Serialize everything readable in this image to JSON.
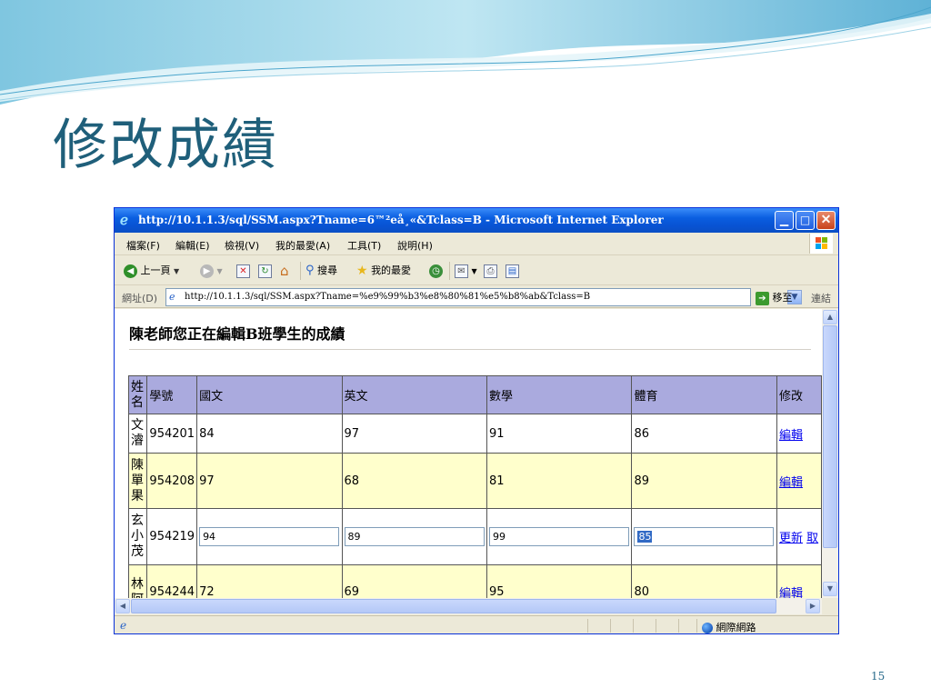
{
  "slide": {
    "title": "修改成績",
    "page_number": "15"
  },
  "browser": {
    "window_title": "http://10.1.1.3/sql/SSM.aspx?Tname=6™²eå¸«&Tclass=B - Microsoft Internet Explorer",
    "menu": [
      "檔案(F)",
      "編輯(E)",
      "檢視(V)",
      "我的最愛(A)",
      "工具(T)",
      "說明(H)"
    ],
    "toolbar": {
      "back_label": "上一頁",
      "search_label": "搜尋",
      "favorites_label": "我的最愛"
    },
    "address": {
      "label": "網址(D)",
      "url": "http://10.1.1.3/sql/SSM.aspx?Tname=%e9%99%b3%e8%80%81%e5%b8%ab&Tclass=B",
      "go_label": "移至",
      "links_label": "連結"
    },
    "status": {
      "zone_label": "網際網路"
    }
  },
  "page": {
    "heading": "陳老師您正在編輯B班學生的成績",
    "columns": [
      "姓名",
      "學號",
      "國文",
      "英文",
      "數學",
      "體育",
      "修改"
    ],
    "rows": [
      {
        "name": "文濬",
        "id": "954201",
        "chinese": "84",
        "english": "97",
        "math": "91",
        "pe": "86",
        "action": "編輯"
      },
      {
        "name": "陳單果",
        "id": "954208",
        "chinese": "97",
        "english": "68",
        "math": "81",
        "pe": "89",
        "action": "編輯"
      },
      {
        "name": "玄小茂",
        "id": "954219",
        "chinese": "94",
        "english": "89",
        "math": "99",
        "pe": "85",
        "action_update": "更新",
        "action_cancel": "取"
      },
      {
        "name": "林阿",
        "id": "954244",
        "chinese": "72",
        "english": "69",
        "math": "95",
        "pe": "80",
        "action": "編輯"
      }
    ]
  },
  "colors": {
    "header_bg": "#aaaade",
    "alt_row_bg": "#ffffcc",
    "title_color": "#1f5f7a",
    "xp_titlebar": "#0a5ee0"
  }
}
